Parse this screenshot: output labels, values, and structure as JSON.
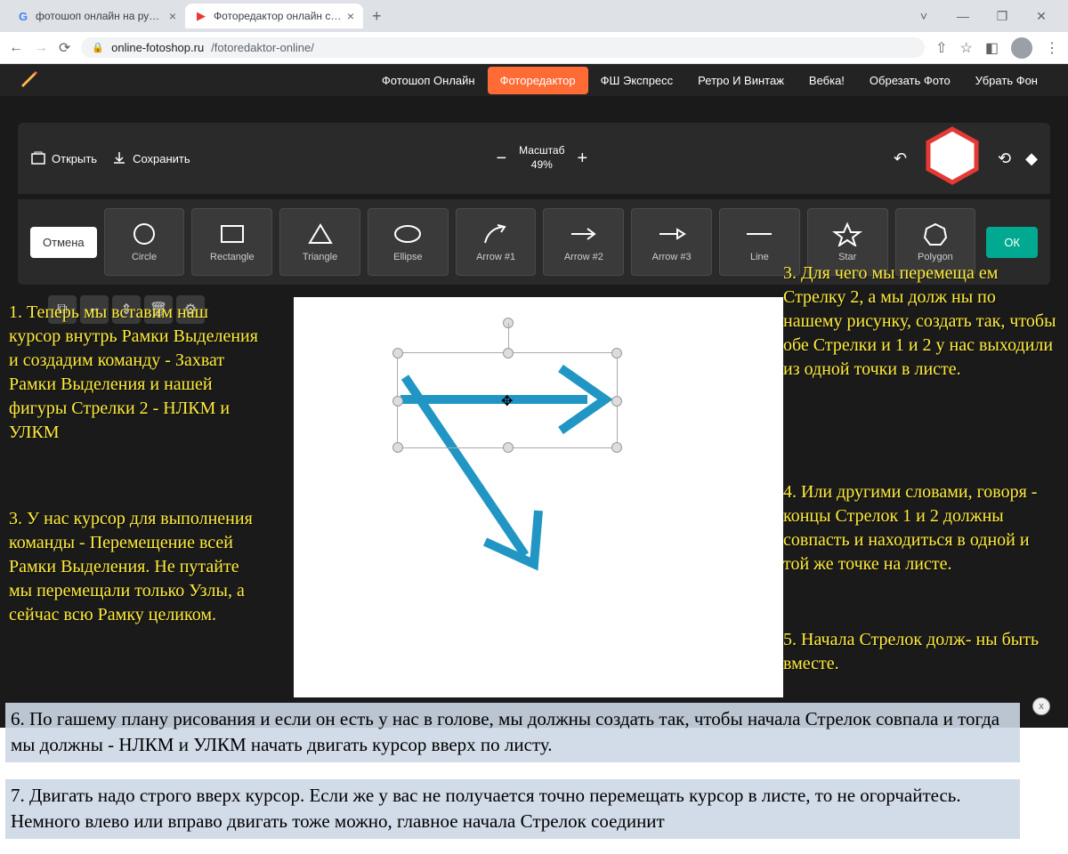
{
  "browser": {
    "tabs": [
      {
        "title": "фотошоп онлайн на русском - ",
        "favicon": "G"
      },
      {
        "title": "Фоторедактор онлайн с эффект",
        "favicon": "▶"
      }
    ],
    "url_host": "online-fotoshop.ru",
    "url_path": "/fotoredaktor-online/",
    "win": {
      "min": "—",
      "max": "❐",
      "close": "✕",
      "down": "˅"
    }
  },
  "nav": {
    "items": [
      "Фотошоп Онлайн",
      "Фоторедактор",
      "ФШ Экспресс",
      "Ретро И Винтаж",
      "Вебка!",
      "Обрезать Фото",
      "Убрать Фон"
    ],
    "active_index": 1
  },
  "toolbar": {
    "open": "Открыть",
    "save": "Сохранить",
    "zoom_label": "Масштаб",
    "zoom_value": "49%"
  },
  "shapes": {
    "cancel": "Отмена",
    "ok": "ОК",
    "items": [
      {
        "label": "Circle"
      },
      {
        "label": "Rectangle"
      },
      {
        "label": "Triangle"
      },
      {
        "label": "Ellipse"
      },
      {
        "label": "Arrow #1"
      },
      {
        "label": "Arrow #2"
      },
      {
        "label": "Arrow #3"
      },
      {
        "label": "Line"
      },
      {
        "label": "Star"
      },
      {
        "label": "Polygon"
      }
    ]
  },
  "annot": {
    "left1": "1. Теперь мы вставим наш курсор внутрь Рамки Выделения и создадим команду - Захват Рамки Выделения и нашей фигуры Стрелки  2 - НЛКМ и УЛКМ",
    "left2": " 3. У нас курсор для  выполнения команды - Перемещение всей Рамки Выделения. Не путайте мы перемещали только Узлы, а сейчас всю Рамку целиком.",
    "right1": "3. Для чего мы перемеща ем Стрелку 2, а мы долж ны по нашему рисунку, создать так, чтобы обе  Стрелки и 1 и 2 у нас  выходили из одной точки в листе.",
    "right2": " 4. Или другими словами, говоря - концы Стрелок  1 и 2 должны совпасть и находиться в одной и той же точке на листе.",
    "right3": " 5. Начала Стрелок долж- ны быть вместе.",
    "bottom1": "6. По гашему плану рисования и если он есть у нас в голове, мы должны создать так, чтобы начала  Стрелок совпала и тогда мы должны - НЛКМ и УЛКМ начать двигать курсор вверх по листу.",
    "bottom2": "7. Двигать надо строго вверх курсор. Если же у вас не получается точно перемещать курсор в листе, то не огорчайтесь. Немного влево или вправо двигать тоже можно, главное начала Стрелок соединит",
    "close_x": "x"
  }
}
